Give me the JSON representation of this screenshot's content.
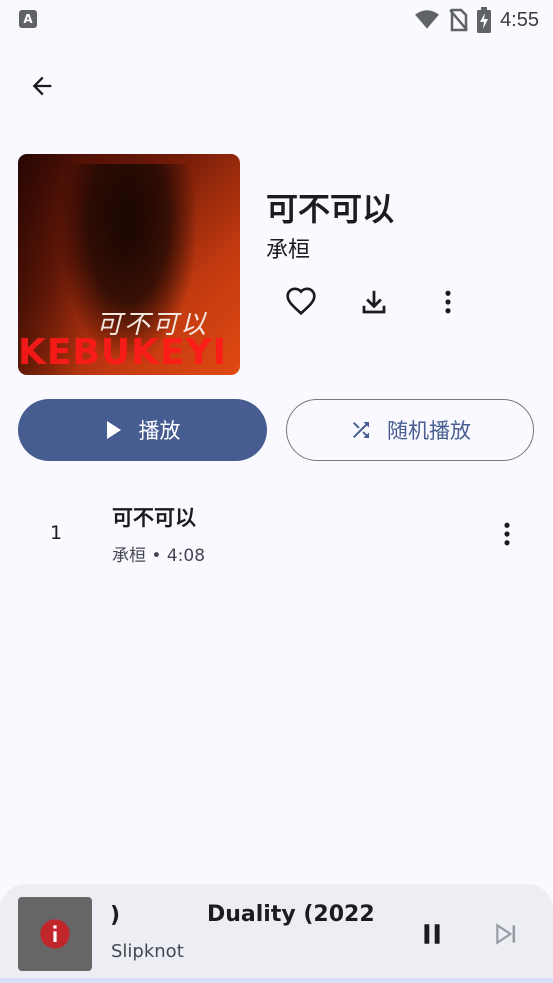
{
  "status_bar": {
    "time": "4:55",
    "left_icon_glyph": "A"
  },
  "album": {
    "title": "可不可以",
    "artist": "承桓",
    "cover_script": "可不可以",
    "cover_text": "KEBUKEYI"
  },
  "buttons": {
    "play_label": "播放",
    "shuffle_label": "随机播放"
  },
  "tracks": [
    {
      "number": "1",
      "title": "可不可以",
      "subtitle": "承桓 • 4:08"
    }
  ],
  "mini_player": {
    "title_fragment": ")",
    "title": "Duality (2022",
    "artist": "Slipknot"
  },
  "colors": {
    "accent": "#475d92",
    "background": "#f9f9ff",
    "mini_player_bg": "#eceef4",
    "error_red": "#c0262a"
  },
  "icons": [
    "arrow-back-icon",
    "heart-icon",
    "download-icon",
    "more-vert-icon",
    "play-icon",
    "shuffle-icon",
    "pause-icon",
    "skip-next-icon",
    "info-icon",
    "wifi-icon",
    "no-sim-icon",
    "battery-charging-icon"
  ]
}
